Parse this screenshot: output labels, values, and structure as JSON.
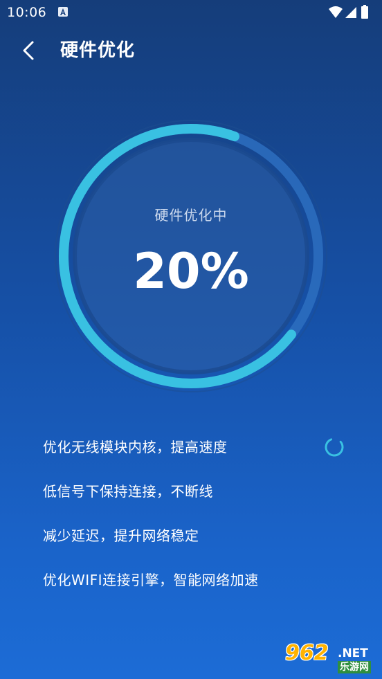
{
  "status_bar": {
    "time": "10:06",
    "icons": [
      "a-icon",
      "wifi-icon",
      "signal-icon",
      "battery-icon"
    ]
  },
  "header": {
    "back_icon": "chevron-left-icon",
    "title": "硬件优化"
  },
  "gauge": {
    "caption": "硬件优化中",
    "percent_text": "20%",
    "progress": 0.2,
    "colors": {
      "progress": "#39c1e2",
      "track": "#2d6fbf",
      "inner": "#2e5fa6"
    }
  },
  "tasks": [
    {
      "label": "优化无线模块内核，提高速度",
      "state": "in-progress"
    },
    {
      "label": "低信号下保持连接，不断线",
      "state": "pending"
    },
    {
      "label": "减少延迟，提升网络稳定",
      "state": "pending"
    },
    {
      "label": "优化WIFI连接引擎，智能网络加速",
      "state": "pending"
    }
  ],
  "watermark": {
    "number": "962",
    "domain": ".NET",
    "sub": "乐游网"
  }
}
